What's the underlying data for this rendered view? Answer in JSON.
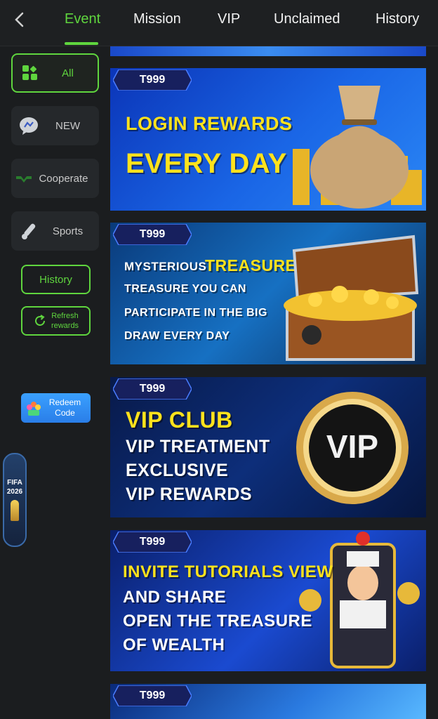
{
  "topbar": {
    "tabs": [
      {
        "label": "Event",
        "active": true
      },
      {
        "label": "Mission",
        "active": false
      },
      {
        "label": "VIP",
        "active": false
      },
      {
        "label": "Unclaimed",
        "active": false
      },
      {
        "label": "History",
        "active": false
      }
    ]
  },
  "sidebar": {
    "categories": [
      {
        "label": "All",
        "icon": "grid-icon",
        "active": true
      },
      {
        "label": "NEW",
        "icon": "chat-bubble-icon",
        "active": false
      },
      {
        "label": "Cooperate",
        "icon": "handshake-icon",
        "active": false
      },
      {
        "label": "Sports",
        "icon": "bat-ball-icon",
        "active": false
      }
    ],
    "history_label": "History",
    "refresh_label_1": "Refresh",
    "refresh_label_2": "rewards",
    "redeem_label_1": "Redeem",
    "redeem_label_2": "Code",
    "fifa_line_1": "FIFA",
    "fifa_line_2": "2026"
  },
  "banners": [
    {
      "badge": "T999",
      "lines": [
        "LOGIN REWARDS",
        "EVERY DAY"
      ],
      "icon": "money-bag-icon"
    },
    {
      "badge": "T999",
      "line_a": "MYSTERIOUS",
      "line_b": "TREASURE BOX",
      "lines": [
        "TREASURE YOU CAN",
        "PARTICIPATE IN THE BIG",
        "DRAW EVERY DAY"
      ],
      "icon": "treasure-chest-icon"
    },
    {
      "badge": "T999",
      "lines": [
        "VIP CLUB",
        "VIP TREATMENT",
        "EXCLUSIVE",
        "VIP REWARDS"
      ],
      "medal": "VIP"
    },
    {
      "badge": "T999",
      "lines": [
        "INVITE TUTORIALS VIEW",
        "AND SHARE",
        "OPEN THE TREASURE",
        "OF WEALTH"
      ],
      "icon": "slot-machine-icon"
    },
    {
      "badge": "T999"
    }
  ],
  "colors": {
    "accent": "#5fd53e",
    "badge": "#17205e",
    "headline_yellow": "#ffe21c"
  }
}
